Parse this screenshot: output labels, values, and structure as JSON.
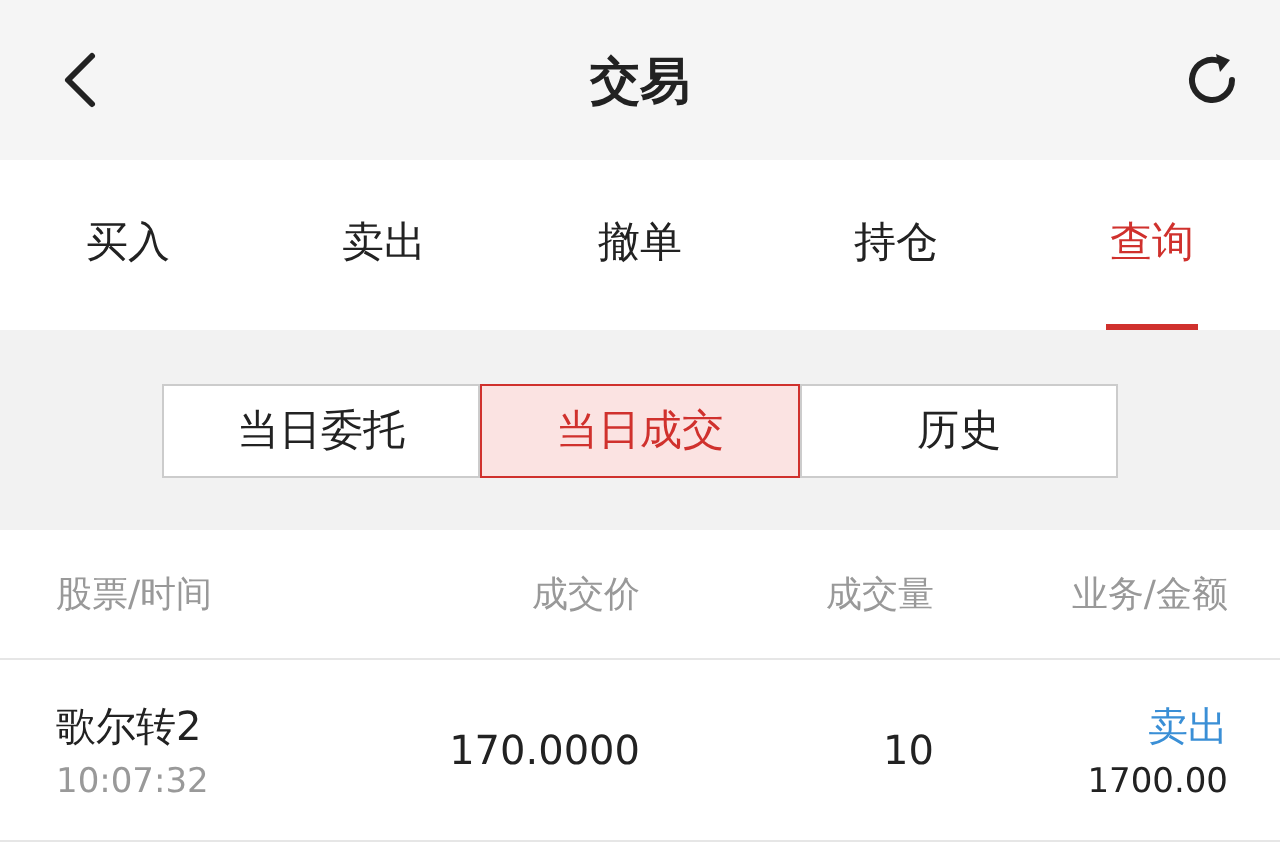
{
  "header": {
    "title": "交易"
  },
  "tabs": [
    {
      "label": "买入",
      "selected": false
    },
    {
      "label": "卖出",
      "selected": false
    },
    {
      "label": "撤单",
      "selected": false
    },
    {
      "label": "持仓",
      "selected": false
    },
    {
      "label": "查询",
      "selected": true
    }
  ],
  "segments": [
    {
      "label": "当日委托",
      "selected": false
    },
    {
      "label": "当日成交",
      "selected": true
    },
    {
      "label": "历史",
      "selected": false
    }
  ],
  "table": {
    "columns": [
      "股票/时间",
      "成交价",
      "成交量",
      "业务/金额"
    ],
    "rows": [
      {
        "stock": "歌尔转2",
        "time": "10:07:32",
        "price": "170.0000",
        "volume": "10",
        "business": "卖出",
        "kind": "sell",
        "amount": "1700.00"
      }
    ]
  }
}
